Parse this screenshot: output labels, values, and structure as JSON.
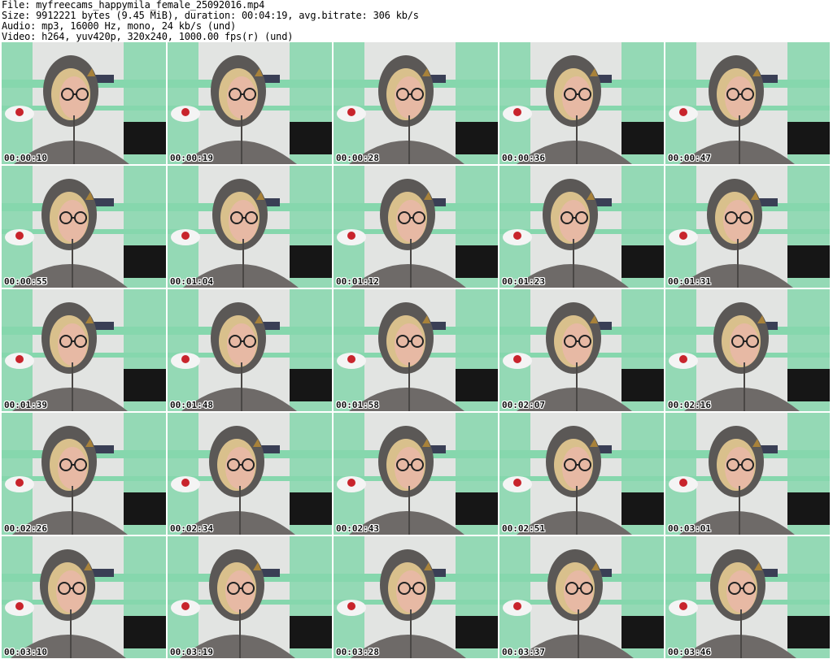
{
  "header": {
    "file_line": "File: myfreecams_happymila_female_25092016.mp4",
    "size_line": "Size: 9912221 bytes (9.45 MiB), duration: 00:04:19, avg.bitrate: 306 kb/s",
    "audio_line": "Audio: mp3, 16000 Hz, mono, 24 kb/s (und)",
    "video_line": "Video: h264, yuv420p, 320x240, 1000.00 fps(r) (und)"
  },
  "frames": [
    {
      "time": "00:00:10"
    },
    {
      "time": "00:00:19"
    },
    {
      "time": "00:00:28"
    },
    {
      "time": "00:00:36"
    },
    {
      "time": "00:00:47"
    },
    {
      "time": "00:00:55"
    },
    {
      "time": "00:01:04"
    },
    {
      "time": "00:01:12"
    },
    {
      "time": "00:01:23"
    },
    {
      "time": "00:01:31"
    },
    {
      "time": "00:01:39"
    },
    {
      "time": "00:01:48"
    },
    {
      "time": "00:01:58"
    },
    {
      "time": "00:02:07"
    },
    {
      "time": "00:02:16"
    },
    {
      "time": "00:02:26"
    },
    {
      "time": "00:02:34"
    },
    {
      "time": "00:02:43"
    },
    {
      "time": "00:02:51"
    },
    {
      "time": "00:03:01"
    },
    {
      "time": "00:03:10"
    },
    {
      "time": "00:03:19"
    },
    {
      "time": "00:03:28"
    },
    {
      "time": "00:03:37"
    },
    {
      "time": "00:03:46"
    }
  ],
  "colors": {
    "wall": "#e2e4e2",
    "shelf": "#86d7ad",
    "hoodie": "#6e6a68",
    "hair": "#d9c08c",
    "skin": "#e7b9a4"
  }
}
